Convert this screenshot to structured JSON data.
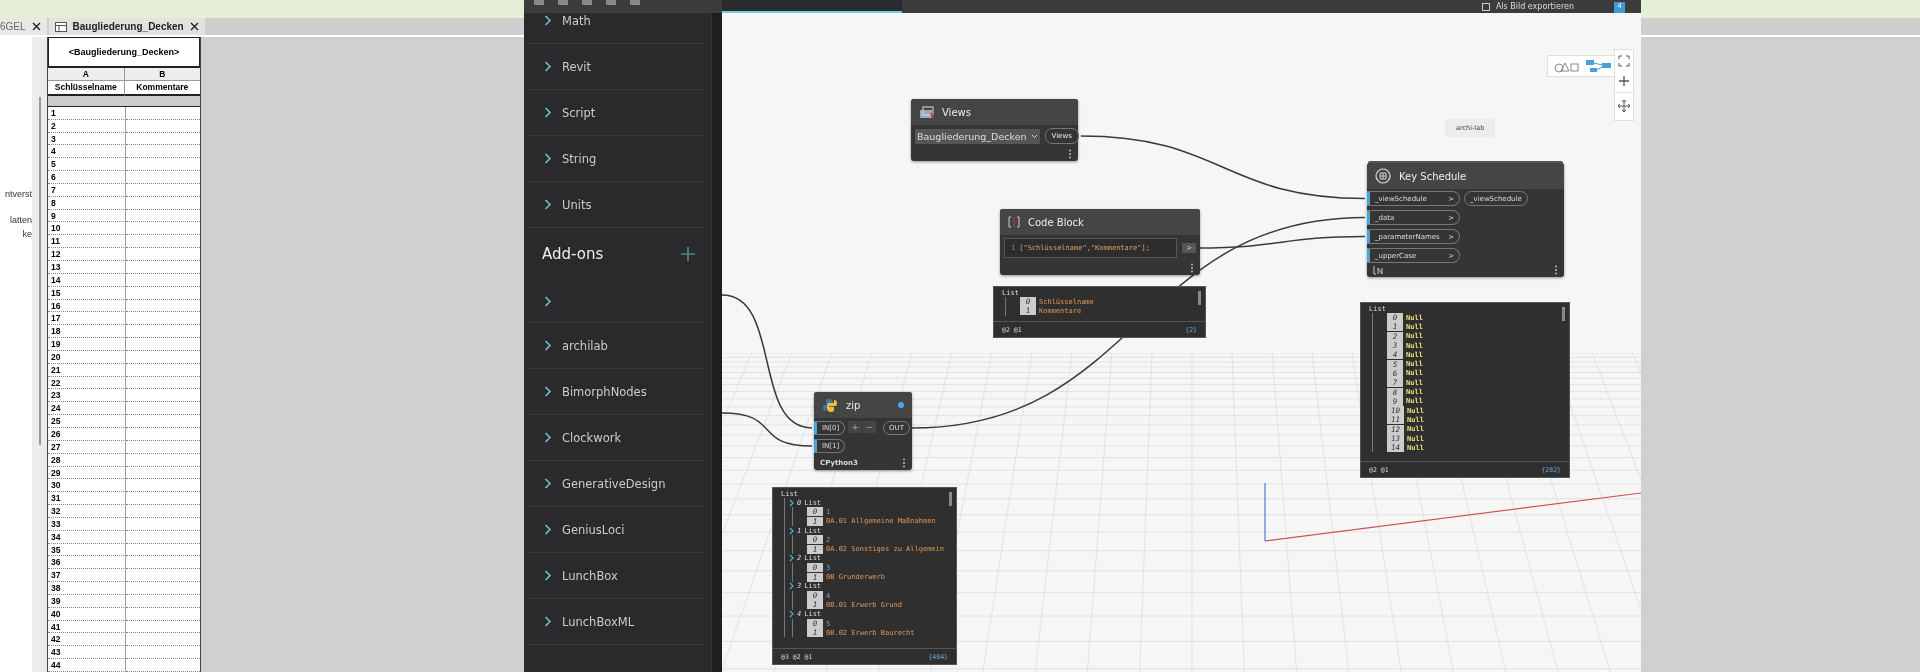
{
  "revit": {
    "tabs": [
      {
        "label": "6GEL",
        "selected": false
      },
      {
        "label": "Baugliederung_Decken",
        "selected": true
      }
    ],
    "browser_items": [
      "ntverst",
      "latten",
      "ke"
    ],
    "schedule": {
      "title": "<Baugliederung_Decken>",
      "column_letters": [
        "A",
        "B"
      ],
      "columns": [
        "Schlüsselname",
        "Kommentare"
      ],
      "rows": [
        "1",
        "2",
        "3",
        "4",
        "5",
        "6",
        "7",
        "8",
        "9",
        "10",
        "11",
        "12",
        "13",
        "14",
        "15",
        "16",
        "17",
        "18",
        "19",
        "20",
        "21",
        "22",
        "23",
        "24",
        "25",
        "26",
        "27",
        "28",
        "29",
        "30",
        "31",
        "32",
        "33",
        "34",
        "35",
        "36",
        "37",
        "38",
        "39",
        "40",
        "41",
        "42",
        "43",
        "44"
      ]
    }
  },
  "dynamo": {
    "toolbar": {
      "export_label": "Als Bild exportieren",
      "badge": "4"
    },
    "library": {
      "categories": [
        "Math",
        "Revit",
        "Script",
        "String",
        "Units"
      ],
      "addons_title": "Add-ons",
      "addons": [
        {
          "kind": "blank"
        },
        {
          "kind": "package",
          "label": "archilab"
        },
        {
          "kind": "package",
          "label": "BimorphNodes"
        },
        {
          "kind": "package",
          "label": "Clockwork"
        },
        {
          "kind": "package",
          "label": "GenerativeDesign"
        },
        {
          "kind": "package",
          "label": "GeniusLoci"
        },
        {
          "kind": "package",
          "label": "LunchBox"
        },
        {
          "kind": "package",
          "label": "LunchBoxML"
        }
      ]
    },
    "canvas": {
      "group_label": "archi-lab",
      "views_node": {
        "title": "Views",
        "value": "Baugliederung_Decken",
        "output": "Views"
      },
      "code_block": {
        "title": "Code Block",
        "line_number": "1",
        "code": "[\"Schlüsselname\",\"Kommentare\"];",
        "output": ">",
        "watch": {
          "label": "List",
          "items": [
            {
              "index": "0",
              "value": "Schlüsselname",
              "kind": "string"
            },
            {
              "index": "1",
              "value": "Kommentare",
              "kind": "string"
            }
          ],
          "levels": "@2 @1",
          "count": "{2}"
        }
      },
      "key_schedule": {
        "title": "Key Schedule",
        "inputs": [
          {
            "label": "_viewSchedule",
            "arrow": ">"
          },
          {
            "label": "_data",
            "arrow": ">"
          },
          {
            "label": "_parameterNames",
            "arrow": ">"
          },
          {
            "label": "_upperCase",
            "arrow": ">"
          }
        ],
        "output": "_viewSchedule",
        "watch": {
          "label": "List",
          "items": [
            {
              "index": "0",
              "value": "Null",
              "kind": "null"
            },
            {
              "index": "1",
              "value": "Null",
              "kind": "null"
            },
            {
              "index": "2",
              "value": "Null",
              "kind": "null"
            },
            {
              "index": "3",
              "value": "Null",
              "kind": "null"
            },
            {
              "index": "4",
              "value": "Null",
              "kind": "null"
            },
            {
              "index": "5",
              "value": "Null",
              "kind": "null"
            },
            {
              "index": "6",
              "value": "Null",
              "kind": "null"
            },
            {
              "index": "7",
              "value": "Null",
              "kind": "null"
            },
            {
              "index": "8",
              "value": "Null",
              "kind": "null"
            },
            {
              "index": "9",
              "value": "Null",
              "kind": "null"
            },
            {
              "index": "10",
              "value": "Null",
              "kind": "null"
            },
            {
              "index": "11",
              "value": "Null",
              "kind": "null"
            },
            {
              "index": "12",
              "value": "Null",
              "kind": "null"
            },
            {
              "index": "13",
              "value": "Null",
              "kind": "null"
            },
            {
              "index": "14",
              "value": "Null",
              "kind": "null"
            }
          ],
          "levels": "@2 @1",
          "count": "{282}"
        }
      },
      "zip_node": {
        "title": "zip",
        "inputs": [
          "IN[0]",
          "IN[1]"
        ],
        "add": "+",
        "remove": "−",
        "output": "OUT",
        "engine": "CPython3",
        "watch": {
          "label": "List",
          "items": [
            {
              "index": "0",
              "label": "List",
              "kind": "list",
              "children": [
                {
                  "index": "0",
                  "value": "1",
                  "kind": "number"
                },
                {
                  "index": "1",
                  "value": "0A.01 Allgemeine Maßnahmen",
                  "kind": "string"
                }
              ]
            },
            {
              "index": "1",
              "label": "List",
              "kind": "list",
              "children": [
                {
                  "index": "0",
                  "value": "2",
                  "kind": "number"
                },
                {
                  "index": "1",
                  "value": "0A.02 Sonstiges zu Allgemein",
                  "kind": "string"
                }
              ]
            },
            {
              "index": "2",
              "label": "List",
              "kind": "list",
              "children": [
                {
                  "index": "0",
                  "value": "3",
                  "kind": "number"
                },
                {
                  "index": "1",
                  "value": "0B Grunderwerb",
                  "kind": "string"
                }
              ]
            },
            {
              "index": "3",
              "label": "List",
              "kind": "list",
              "children": [
                {
                  "index": "0",
                  "value": "4",
                  "kind": "number"
                },
                {
                  "index": "1",
                  "value": "0B.01 Erwerb Grund",
                  "kind": "string"
                }
              ]
            },
            {
              "index": "4",
              "label": "List",
              "kind": "list",
              "children": [
                {
                  "index": "0",
                  "value": "5",
                  "kind": "number"
                },
                {
                  "index": "1",
                  "value": "0B.02 Erwerb Baurecht",
                  "kind": "string"
                }
              ]
            }
          ],
          "levels": "@3 @2 @1",
          "count": "{404}"
        }
      }
    }
  }
}
